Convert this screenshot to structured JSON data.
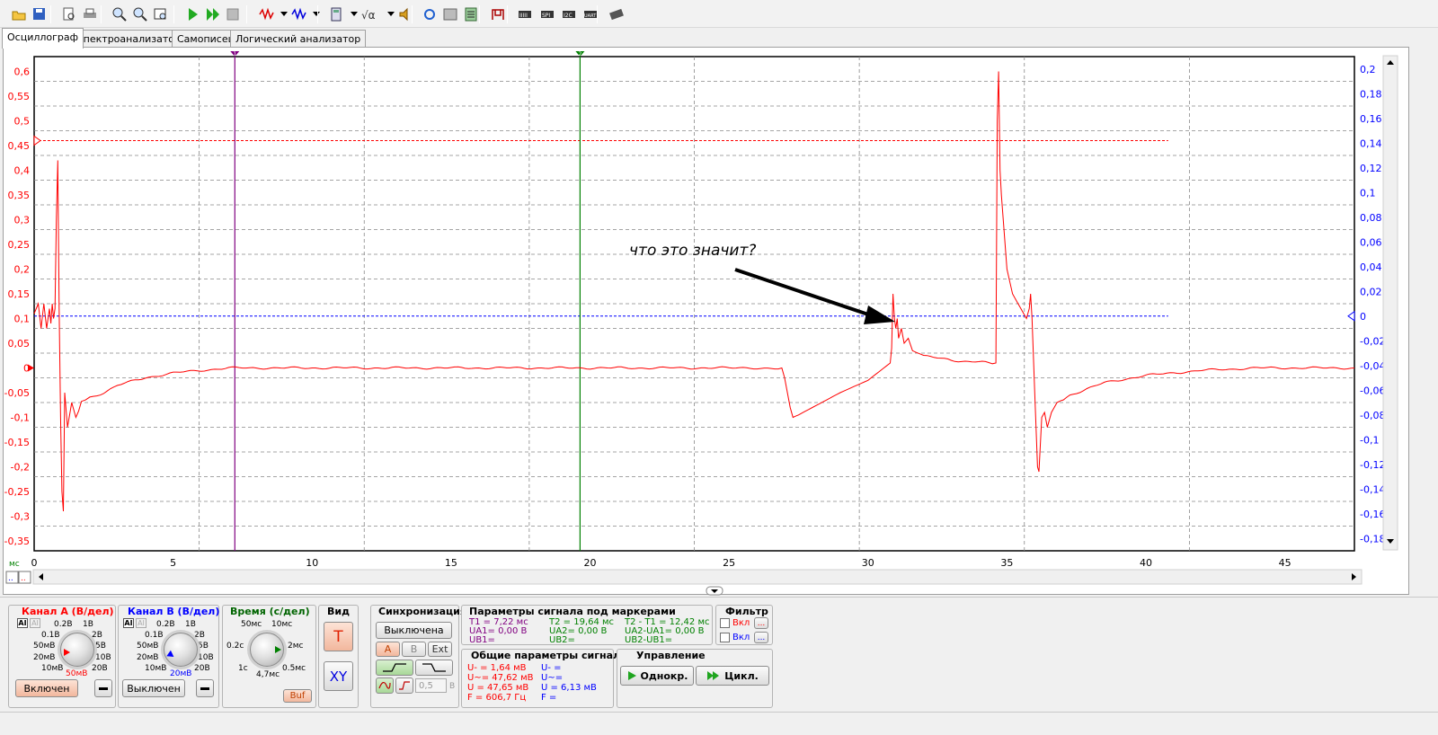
{
  "toolbar": {
    "icons": [
      "open-icon",
      "save-icon",
      "print-preview-icon",
      "print-icon",
      "zoom-in-icon",
      "zoom-out-icon",
      "zoom-fit-icon",
      "start-icon",
      "start-cycle-icon",
      "stop-icon",
      "channel-a-icon",
      "channel-b-icon",
      "calculator-icon",
      "math-icon",
      "sound-icon",
      "refresh-icon",
      "settings-icon",
      "report-icon",
      "generator-icon",
      "chip-icon",
      "spi-icon",
      "i2c-icon",
      "uart-icon",
      "device-icon"
    ]
  },
  "tabs": [
    "Осциллограф",
    "Спектроанализатор",
    "Самописец",
    "Логический анализатор"
  ],
  "scope": {
    "left_axis_ticks": [
      "0,6",
      "0,55",
      "0,5",
      "0,45",
      "0,4",
      "0,35",
      "0,3",
      "0,25",
      "0,2",
      "0,15",
      "0,1",
      "0,05",
      "0",
      "-0,05",
      "-0,1",
      "-0,15",
      "-0,2",
      "-0,25",
      "-0,3",
      "-0,35"
    ],
    "right_axis_ticks": [
      "0,2",
      "0,18",
      "0,16",
      "0,14",
      "0,12",
      "0,1",
      "0,08",
      "0,06",
      "0,04",
      "0,02",
      "0",
      "-0,02",
      "-0,04",
      "-0,06",
      "-0,08",
      "-0,1",
      "-0,12",
      "-0,14",
      "-0,16",
      "-0,18"
    ],
    "x_ticks": [
      "0",
      "5",
      "10",
      "15",
      "20",
      "25",
      "30",
      "35",
      "40",
      "45"
    ],
    "x_unit": "мс",
    "annotation": "что это значит?",
    "marker_t1": "1",
    "marker_t2": "2",
    "colors": {
      "channel_a": "#ff0000",
      "channel_b": "#0000ff",
      "marker1": "#800080",
      "marker2": "#008000"
    }
  },
  "chart_data": {
    "type": "line",
    "xlabel": "мс",
    "xlim": [
      0,
      47.5
    ],
    "ylim": [
      -0.37,
      0.63
    ],
    "y2lim": [
      -0.19,
      0.21
    ],
    "trigger_level_a": 0.46,
    "trigger_level_b": 0,
    "marker_t1_ms": 7.22,
    "marker_t2_ms": 19.64,
    "series": [
      {
        "name": "Канал A",
        "points": [
          [
            0,
            0.11
          ],
          [
            0.15,
            0.13
          ],
          [
            0.25,
            0.08
          ],
          [
            0.35,
            0.13
          ],
          [
            0.45,
            0.08
          ],
          [
            0.55,
            0.12
          ],
          [
            0.6,
            0.09
          ],
          [
            0.65,
            0.13
          ],
          [
            0.7,
            0.1
          ],
          [
            0.75,
            0.12
          ],
          [
            0.8,
            0.3
          ],
          [
            0.85,
            0.42
          ],
          [
            0.9,
            0.12
          ],
          [
            0.95,
            -0.1
          ],
          [
            1.0,
            -0.25
          ],
          [
            1.05,
            -0.29
          ],
          [
            1.1,
            -0.05
          ],
          [
            1.2,
            -0.12
          ],
          [
            1.35,
            -0.07
          ],
          [
            1.5,
            -0.1
          ],
          [
            1.7,
            -0.07
          ],
          [
            2,
            -0.06
          ],
          [
            2.5,
            -0.05
          ],
          [
            3,
            -0.035
          ],
          [
            4,
            -0.02
          ],
          [
            5,
            -0.01
          ],
          [
            6,
            -0.005
          ],
          [
            7,
            0
          ],
          [
            10,
            0
          ],
          [
            15,
            0
          ],
          [
            20,
            0
          ],
          [
            25,
            0
          ],
          [
            26.9,
            0
          ],
          [
            27,
            -0.02
          ],
          [
            27.2,
            -0.08
          ],
          [
            27.3,
            -0.1
          ],
          [
            27.5,
            -0.095
          ],
          [
            28,
            -0.08
          ],
          [
            29,
            -0.05
          ],
          [
            30,
            -0.025
          ],
          [
            30.8,
            0.01
          ],
          [
            30.85,
            0.04
          ],
          [
            30.9,
            0.15
          ],
          [
            30.95,
            0.1
          ],
          [
            31,
            0.08
          ],
          [
            31.05,
            0.1
          ],
          [
            31.1,
            0.06
          ],
          [
            31.2,
            0.08
          ],
          [
            31.3,
            0.05
          ],
          [
            31.45,
            0.06
          ],
          [
            31.6,
            0.035
          ],
          [
            32,
            0.025
          ],
          [
            33,
            0.015
          ],
          [
            34.6,
            0.01
          ],
          [
            34.65,
            0.5
          ],
          [
            34.7,
            0.6
          ],
          [
            34.75,
            0.4
          ],
          [
            34.8,
            0.35
          ],
          [
            35,
            0.2
          ],
          [
            35.2,
            0.15
          ],
          [
            35.5,
            0.12
          ],
          [
            35.7,
            0.1
          ],
          [
            35.8,
            0.12
          ],
          [
            35.85,
            0.15
          ],
          [
            35.9,
            0.1
          ],
          [
            36,
            -0.05
          ],
          [
            36.1,
            -0.2
          ],
          [
            36.15,
            -0.21
          ],
          [
            36.25,
            -0.1
          ],
          [
            36.35,
            -0.09
          ],
          [
            36.45,
            -0.12
          ],
          [
            36.6,
            -0.09
          ],
          [
            36.8,
            -0.07
          ],
          [
            37.5,
            -0.05
          ],
          [
            38.5,
            -0.03
          ],
          [
            40,
            -0.015
          ],
          [
            42,
            -0.005
          ],
          [
            44,
            0
          ],
          [
            47.5,
            0
          ]
        ]
      }
    ]
  },
  "channel_a": {
    "title": "Канал A (В/дел)",
    "ticks": [
      "0.2В",
      "1В",
      "0.1В",
      "2В",
      "50мВ",
      "5В",
      "20мВ",
      "10В",
      "10мВ",
      "20В"
    ],
    "value": "50мВ",
    "state_button": "Включен",
    "ac_icon": "AI",
    "dc_icon": "AI"
  },
  "channel_b": {
    "title": "Канал B (В/дел)",
    "ticks": [
      "0.2В",
      "1В",
      "0.1В",
      "2В",
      "50мВ",
      "5В",
      "20мВ",
      "10В",
      "10мВ",
      "20В"
    ],
    "value": "20мВ",
    "state_button": "Выключен",
    "ac_icon": "AI",
    "dc_icon": "AI"
  },
  "time": {
    "title": "Время (с/дел)",
    "ticks": [
      "50мс",
      "10мс",
      "0.2с",
      "2мс",
      "1с",
      "0.5мс"
    ],
    "value": "4,7мс",
    "buf_button": "Buf"
  },
  "view": {
    "title": "Вид",
    "t_button": "T",
    "xy_button": "XY"
  },
  "sync": {
    "title": "Синхронизация",
    "mode_button": "Выключена",
    "source_a": "A",
    "source_b": "B",
    "source_ext": "Ext",
    "level_value": "0,5",
    "level_unit": "В"
  },
  "markers_params": {
    "title": "Параметры сигнала под маркерами",
    "col1": [
      "T1 = 7,22 мс",
      "UA1= 0,00 В",
      "UB1="
    ],
    "col2": [
      "T2 = 19,64 мс",
      "UA2= 0,00 В",
      "UB2="
    ],
    "col3": [
      "T2 - T1 = 12,42 мс",
      "UA2-UA1= 0,00 В",
      "UB2-UB1="
    ]
  },
  "general_params": {
    "title": "Общие параметры сигнала",
    "col_a": [
      "U- = 1,64 мВ",
      "U~= 47,62 мВ",
      "U  = 47,65 мВ",
      "F  = 606,7 Гц"
    ],
    "col_b": [
      "U- =",
      "U~=",
      "U  = 6,13 мВ",
      "F  ="
    ]
  },
  "filter": {
    "title": "Фильтр",
    "a_label": "Вкл",
    "b_label": "Вкл",
    "dots": "..."
  },
  "control": {
    "title": "Управление",
    "single_button": "Однокр.",
    "cycle_button": "Цикл."
  },
  "scroll": {
    "left_btn_a": "..",
    "left_btn_b": ".."
  }
}
